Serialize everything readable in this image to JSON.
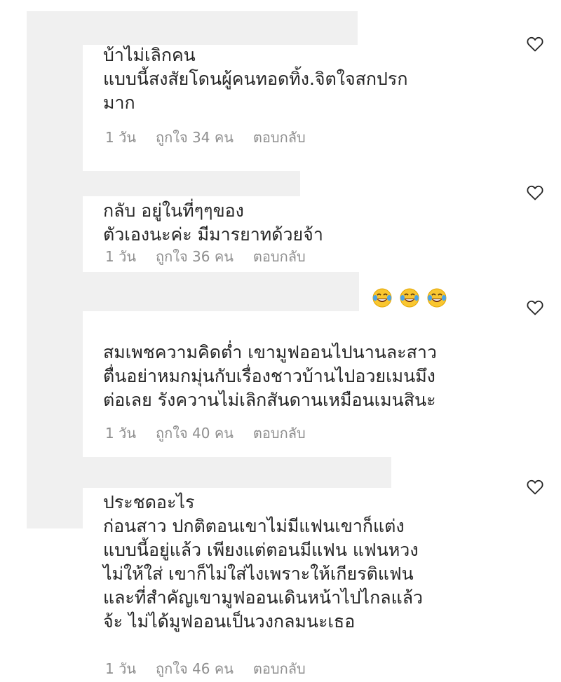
{
  "comments": [
    {
      "text": "บ้าไม่เลิกคน\nแบบนี้สงสัยโดนผู้คนทอดทิ้ง.จิตใจสกปรก\nมาก",
      "time": "1 วัน",
      "likes": "ถูกใจ 34 คน",
      "reply": "ตอบกลับ"
    },
    {
      "text": "กลับ อยู่ในที่ๆๆของ\nตัวเองนะค่ะ มีมารยาทด้วยจ้า",
      "time": "1 วัน",
      "likes": "ถูกใจ 36 คน",
      "reply": "ตอบกลับ"
    },
    {
      "text": "สมเพชความคิดต่ำ เขามูฟออนไปนานละสาว\nตื่นอย่าหมกมุ่นกับเรื่องชาวบ้านไปอวยเมนมึง\nต่อเลย รังควานไม่เลิกสันดานเหมือนเมนสินะ",
      "emoji_count": 3,
      "emoji_name": "tears-of-joy-emoji",
      "time": "1 วัน",
      "likes": "ถูกใจ 40 คน",
      "reply": "ตอบกลับ"
    },
    {
      "text": "ประชดอะไร\nก่อนสาว ปกติตอนเขาไม่มีแฟนเขาก็แต่ง\nแบบนี้อยู่แล้ว เพียงแต่ตอนมีแฟน แฟนหวง\nไม่ให้ใส่ เขาก็ไม่ใส่ไงเพราะให้เกียรติแฟน\nและที่สำคัญเขามูฟออนเดินหน้าไปไกลแล้ว\nจ้ะ ไม่ได้มูฟออนเป็นวงกลมนะเธอ",
      "time": "1 วัน",
      "likes": "ถูกใจ 46 คน",
      "reply": "ตอบกลับ"
    }
  ],
  "colors": {
    "text": "#262626",
    "meta": "#8e8e8e",
    "redaction": "#f0f0f0"
  }
}
